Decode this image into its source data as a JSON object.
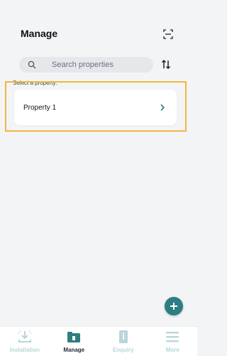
{
  "header": {
    "title": "Manage",
    "scan_icon": "scan-icon"
  },
  "search": {
    "placeholder": "Search properties",
    "value": "",
    "sort_icon": "sort-icon"
  },
  "section": {
    "label": "Select a property:"
  },
  "properties": [
    {
      "name": "Property 1",
      "icon": "chevron-right-icon"
    }
  ],
  "fab": {
    "icon": "plus-icon"
  },
  "bottom_nav": {
    "items": [
      {
        "label": "Installation",
        "icon": "installation-icon",
        "active": false
      },
      {
        "label": "Manage",
        "icon": "manage-icon",
        "active": true
      },
      {
        "label": "Enquiry",
        "icon": "enquiry-icon",
        "active": false
      },
      {
        "label": "More",
        "icon": "menu-icon",
        "active": false
      }
    ]
  },
  "colors": {
    "accent": "#2e7d82",
    "inactive_nav": "#b8d6d7",
    "highlight": "#f2b63f",
    "background": "#f3f4f6"
  }
}
